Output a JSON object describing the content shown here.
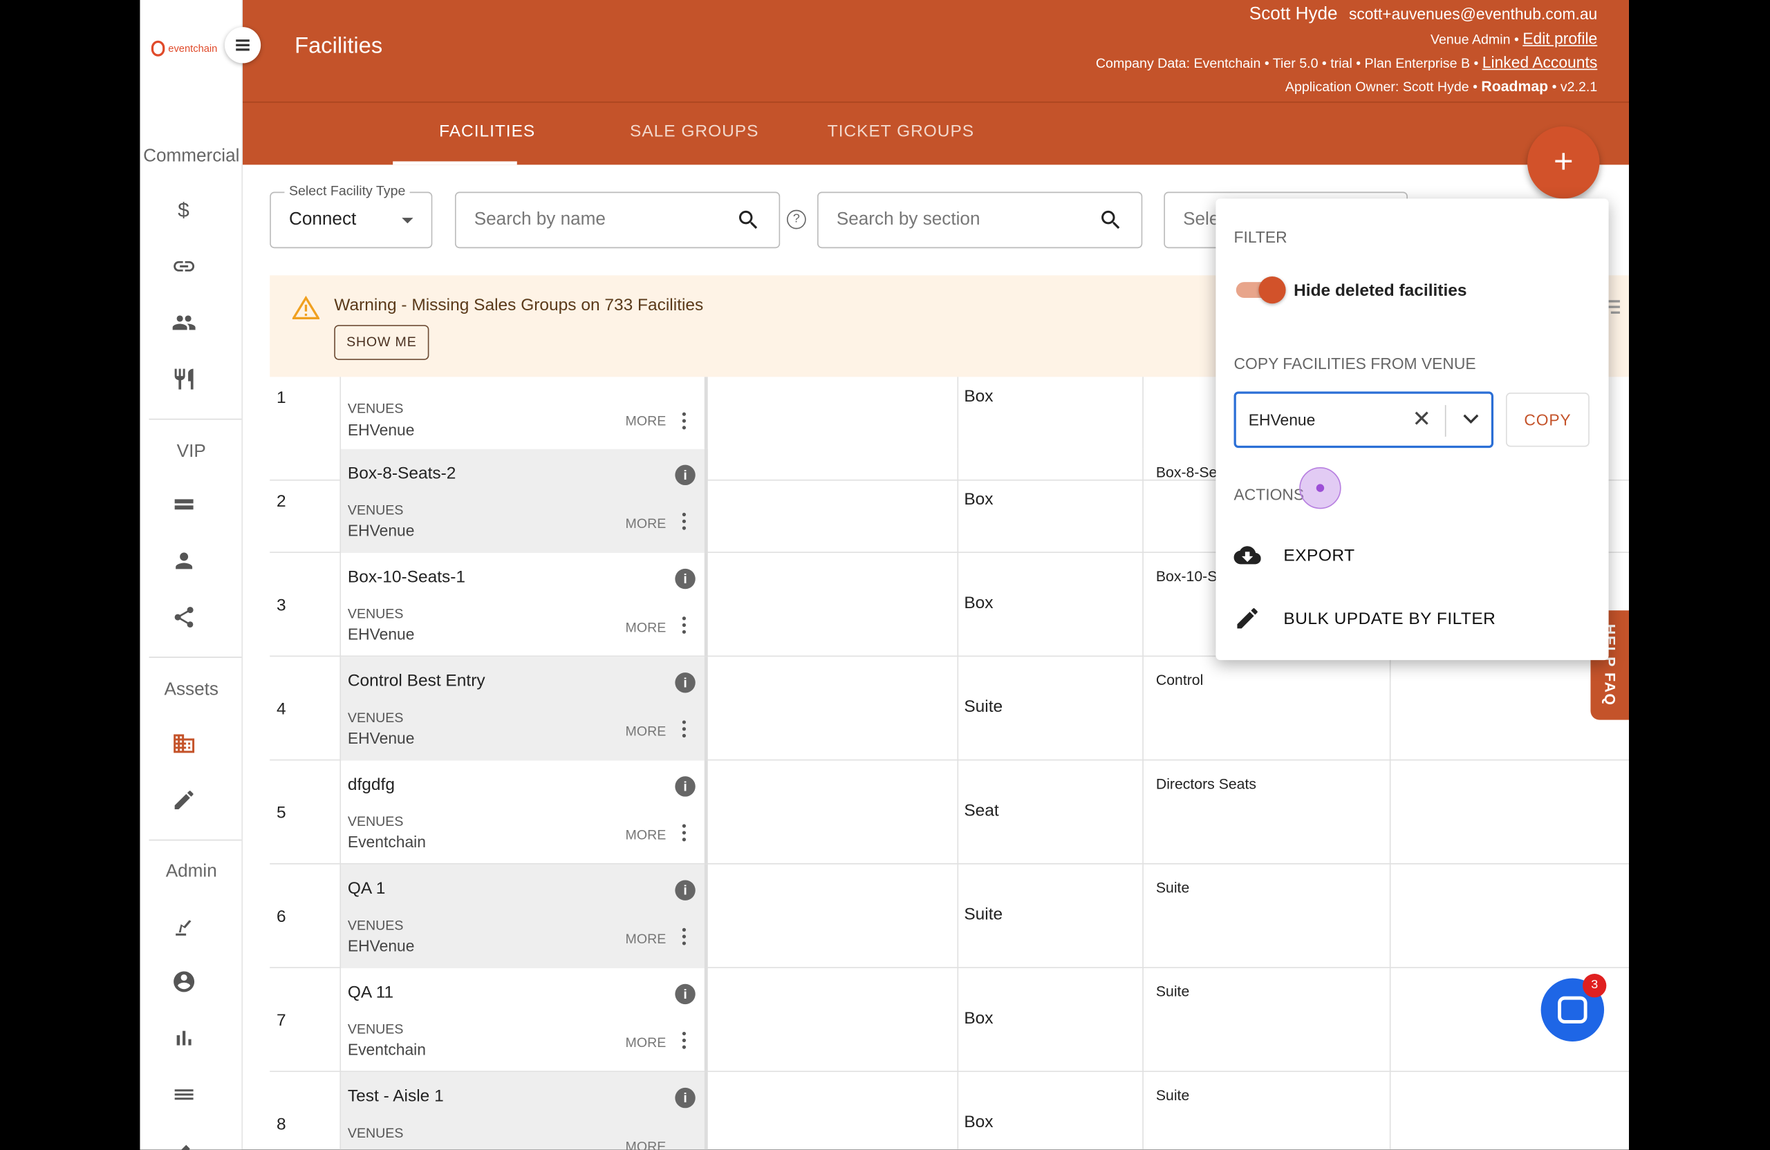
{
  "app": {
    "logo_text": "eventchain",
    "page_title": "Facilities"
  },
  "user": {
    "name": "Scott Hyde",
    "email": "scott+auvenues@eventhub.com.au",
    "role": "Venue Admin",
    "edit_profile": "Edit profile",
    "company_line": "Company Data: Eventchain • Tier 5.0 • trial • Plan Enterprise B •",
    "linked_accounts": "Linked Accounts",
    "owner_line": "Application Owner: Scott Hyde •",
    "roadmap": "Roadmap",
    "version": "• v2.2.1"
  },
  "sidebar": {
    "sections": [
      "Commercial",
      "VIP",
      "Assets",
      "Admin"
    ],
    "icons": [
      "dollar-icon",
      "link-icon",
      "people-icon",
      "restaurant-icon",
      "ticket-icon",
      "person-icon",
      "share-icon",
      "building-icon",
      "pencil-icon",
      "robot-arm-icon",
      "account-circle-icon",
      "bar-chart-icon",
      "list-icon"
    ]
  },
  "tabs": [
    "FACILITIES",
    "SALE GROUPS",
    "TICKET GROUPS"
  ],
  "fab_label": "+",
  "filters": {
    "facility_type_label": "Select Facility Type",
    "facility_type_value": "Connect",
    "search_name_placeholder": "Search by name",
    "search_section_placeholder": "Search by section",
    "select_placeholder": "Sele",
    "help_glyph": "?"
  },
  "warning": {
    "text": "Warning - Missing Sales Groups on 733 Facilities",
    "button": "SHOW ME"
  },
  "rows": [
    {
      "num": "1",
      "name": "",
      "venue_label": "VENUES",
      "venue": "EHVenue",
      "more": "MORE",
      "type": "Box",
      "section": ""
    },
    {
      "num": "2",
      "name": "Box-8-Seats-2",
      "venue_label": "VENUES",
      "venue": "EHVenue",
      "more": "MORE",
      "type": "Box",
      "section": "Box-8-Se"
    },
    {
      "num": "3",
      "name": "Box-10-Seats-1",
      "venue_label": "VENUES",
      "venue": "EHVenue",
      "more": "MORE",
      "type": "Box",
      "section": "Box-10-S"
    },
    {
      "num": "4",
      "name": "Control Best Entry",
      "venue_label": "VENUES",
      "venue": "EHVenue",
      "more": "MORE",
      "type": "Suite",
      "section": "Control"
    },
    {
      "num": "5",
      "name": "dfgdfg",
      "venue_label": "VENUES",
      "venue": "Eventchain",
      "more": "MORE",
      "type": "Seat",
      "section": "Directors Seats"
    },
    {
      "num": "6",
      "name": "QA 1",
      "venue_label": "VENUES",
      "venue": "EHVenue",
      "more": "MORE",
      "type": "Suite",
      "section": "Suite"
    },
    {
      "num": "7",
      "name": "QA 11",
      "venue_label": "VENUES",
      "venue": "Eventchain",
      "more": "MORE",
      "type": "Box",
      "section": "Suite"
    },
    {
      "num": "8",
      "name": "Test - Aisle 1",
      "venue_label": "VENUES",
      "venue": "",
      "more": "MORE",
      "type": "Box",
      "section": "Suite"
    }
  ],
  "popup": {
    "filter_heading": "FILTER",
    "toggle_label": "Hide deleted facilities",
    "copy_heading": "COPY FACILITIES FROM VENUE",
    "venue_value": "EHVenue",
    "clear_glyph": "✕",
    "copy_button": "COPY",
    "actions_heading": "ACTIONS",
    "export_label": "EXPORT",
    "bulk_update_label": "BULK UPDATE BY FILTER"
  },
  "help_faq": "HELP FAQ",
  "chat_badge": "3",
  "colors": {
    "brand": "#c4532a",
    "warning_bg": "#fef3e6",
    "focus": "#2b6fd6",
    "chat": "#1e66e6"
  }
}
